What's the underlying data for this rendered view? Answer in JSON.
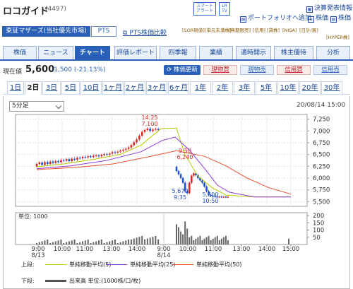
{
  "header": {
    "company_name": "ロコガイド",
    "stock_code": "(4497)",
    "smart_alert": "スマート アラート",
    "lr_tv": "LR TV",
    "earnings_info": "決算発表情報",
    "add_portfolio": "ポートフォリオへ追加",
    "stock_info": "株価",
    "stock_news": "株価"
  },
  "market": {
    "tabs": [
      {
        "label": "東証マザーズ(当社優先市場)",
        "active": true
      },
      {
        "label": "PTS",
        "active": false
      }
    ],
    "pts_compare": "PTS株価比較",
    "tags": [
      "[SOR現値]",
      "[単元未満株]",
      "[無期限売]",
      "[信用]",
      "[貸株]",
      "[NISA]",
      "[日計/買]",
      "[HYPER株]"
    ]
  },
  "nav": {
    "tabs": [
      "株価",
      "ニュース",
      "チャート",
      "評価レポート",
      "四季報",
      "業績",
      "適時開示",
      "株主優待",
      "分析"
    ],
    "active": "チャート"
  },
  "quote": {
    "label": "現在値",
    "price": "5,600",
    "change": "-1,500 (-21.13%)",
    "refresh": "株価更新",
    "buttons": [
      "現物買",
      "現物売",
      "信用買",
      "信用売"
    ]
  },
  "periods": {
    "items": [
      "1日",
      "2日",
      "3日",
      "5日",
      "10日",
      "1ヶ月",
      "2ヶ月",
      "3ヶ月",
      "6ヶ月",
      "1年",
      "2年",
      "3年",
      "5年",
      "10年",
      "20年",
      "30年"
    ],
    "active": "2日"
  },
  "chart": {
    "interval": "5分足",
    "datetime": "20/08/14 15:00"
  },
  "chart_data": {
    "type": "candlestick",
    "y_ticks": [
      "7,250",
      "7,000",
      "6,750",
      "6,500",
      "6,250",
      "6,000",
      "5,750",
      "5,500"
    ],
    "ylim": [
      5400,
      7350
    ],
    "x_ticks": [
      "9:00\n8/13",
      "10:00",
      "11:00",
      "13:00",
      "14:00",
      "9:00\n8/14",
      "10:00",
      "11:00",
      "13:00",
      "14:00",
      "15:00"
    ],
    "annotations": [
      {
        "time": "14:25",
        "value": "7,100"
      },
      {
        "time": "9:50",
        "value": "6,240"
      },
      {
        "time": "9:35",
        "value": "5,670"
      },
      {
        "time": "10:50",
        "value": "5,600"
      }
    ],
    "series": [
      {
        "name": "単純移動平均(5)",
        "color": "#b7c800"
      },
      {
        "name": "単純移動平均(25)",
        "color": "#8a3ad8"
      },
      {
        "name": "単純移動平均(50)",
        "color": "#e8502a"
      }
    ],
    "volume": {
      "unit_label": "単位: 1000",
      "y_ticks": [
        "200",
        "150",
        "100",
        "50"
      ],
      "legend": "出来高 単位:(1000株/口/枚)"
    },
    "legend_upper": "上段:",
    "legend_lower": "下段:"
  }
}
